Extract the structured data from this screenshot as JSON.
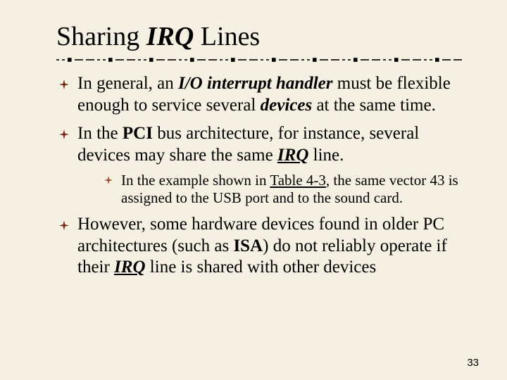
{
  "title": {
    "pre": "Sharing ",
    "irq": "IRQ",
    "post": " Lines"
  },
  "bullets": {
    "b1": {
      "t1": "In general, an ",
      "t2": "I/O interrupt handler",
      "t3": " must be flexible enough to service several ",
      "t4": "devices",
      "t5": " at the same time."
    },
    "b2": {
      "t1": "In the ",
      "t2": "PCI",
      "t3": " bus architecture, for instance, several devices may share the same ",
      "t4": "IRQ",
      "t5": " line."
    },
    "sub1": {
      "t1": "In the example shown in ",
      "t2": "Table 4-3",
      "t3": ", the same vector 43 is assigned to the USB port and to the sound card."
    },
    "b3": {
      "t1": "However, some hardware devices found in older PC architectures (such as ",
      "t2": "ISA",
      "t3": ") do not reliably operate if their ",
      "t4": "IRQ",
      "t5": " line is shared with other devices"
    }
  },
  "page_number": "33"
}
